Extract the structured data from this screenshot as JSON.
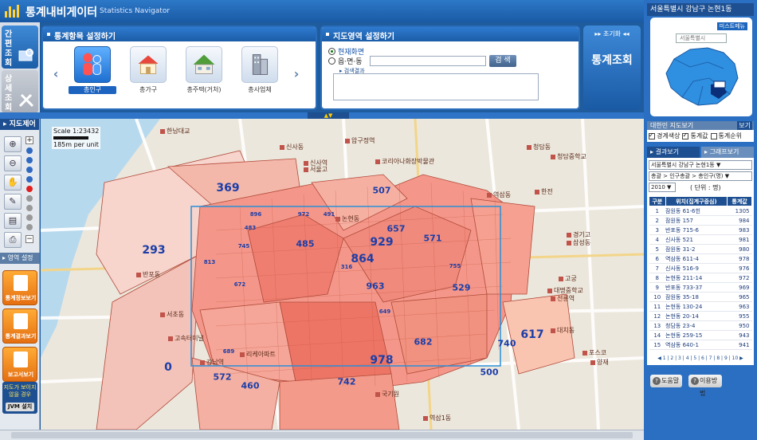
{
  "header": {
    "title": "통계내비게이터",
    "subtitle": "Statistics Navigator"
  },
  "mode_tabs": {
    "simple": "간편조회",
    "detail": "상세조회"
  },
  "stats_panel": {
    "title": "통계항목 설정하기",
    "items": [
      {
        "label": "총인구",
        "icon": "population-icon",
        "active": true
      },
      {
        "label": "총가구",
        "icon": "household-icon",
        "active": false
      },
      {
        "label": "총주택(거처)",
        "icon": "housing-icon",
        "active": false
      },
      {
        "label": "총사업체",
        "icon": "business-icon",
        "active": false
      }
    ]
  },
  "area_panel": {
    "title": "지도영역 설정하기",
    "current_screen": "현재화면",
    "region_option": "읍·면·동",
    "search_button": "검 색",
    "search_result_label": "검색결과",
    "region_input_value": ""
  },
  "query_panel": {
    "reset": "초기화",
    "query": "통계조회"
  },
  "map_tools": {
    "title": "지도제어",
    "layer_title": "영역 설정"
  },
  "side_cards": [
    {
      "label": "통계정보보기"
    },
    {
      "label": "통계결과보기"
    },
    {
      "label": "보고서보기"
    }
  ],
  "jvm": {
    "notice": "지도가 보이지 않을 경우",
    "button": "JVM 설치"
  },
  "map": {
    "scale_label": "Scale 1:23432",
    "scale_unit": "185m per unit",
    "region_values": [
      {
        "v": "369",
        "size": "big"
      },
      {
        "v": "293",
        "size": "big"
      },
      {
        "v": "0",
        "size": "big"
      },
      {
        "v": "864",
        "size": "big"
      },
      {
        "v": "929",
        "size": "big"
      },
      {
        "v": "978",
        "size": "big"
      },
      {
        "v": "617",
        "size": "big"
      },
      {
        "v": "963",
        "size": "mid"
      },
      {
        "v": "571",
        "size": "mid"
      },
      {
        "v": "657",
        "size": "mid"
      },
      {
        "v": "507",
        "size": "mid"
      },
      {
        "v": "485",
        "size": "mid"
      },
      {
        "v": "682",
        "size": "mid"
      },
      {
        "v": "529",
        "size": "mid"
      },
      {
        "v": "460",
        "size": "mid"
      },
      {
        "v": "742",
        "size": "mid"
      },
      {
        "v": "572",
        "size": "mid"
      },
      {
        "v": "500",
        "size": "mid"
      },
      {
        "v": "740",
        "size": "mid"
      },
      {
        "v": "972",
        "size": "sm"
      },
      {
        "v": "896",
        "size": "sm"
      },
      {
        "v": "483",
        "size": "sm"
      },
      {
        "v": "745",
        "size": "sm"
      },
      {
        "v": "672",
        "size": "sm"
      },
      {
        "v": "316",
        "size": "sm"
      },
      {
        "v": "649",
        "size": "sm"
      },
      {
        "v": "689",
        "size": "sm"
      },
      {
        "v": "491",
        "size": "sm"
      },
      {
        "v": "813",
        "size": "sm"
      },
      {
        "v": "755",
        "size": "sm"
      }
    ],
    "poi_labels": [
      "신사동",
      "압구정역",
      "코리아나화장박물관",
      "청담동",
      "논현동",
      "역삼동",
      "삼성동",
      "선릉역",
      "반포동",
      "서초동",
      "강남역",
      "대치동",
      "국기원",
      "역삼1동",
      "신사역",
      "한남대교",
      "고속터미널",
      "청담중학교",
      "리케아파트",
      "서울고",
      "양재",
      "고궁",
      "경기고",
      "한전",
      "포스코",
      "대명중학교"
    ]
  },
  "right_panel": {
    "region_title": "서울특별시 강남구 논현1동",
    "minimap_button": "미스트메뉴",
    "minimap_select": "서울특별시",
    "layers": {
      "title": "대한민 지도보기",
      "tag": "보기",
      "items": [
        {
          "label": "경계색상",
          "checked": true
        },
        {
          "label": "통계값",
          "checked": true
        },
        {
          "label": "통계순위",
          "checked": false
        }
      ]
    },
    "tabs": {
      "result": "결과보기",
      "graph": "그래프보기"
    },
    "select_region": "서울특별시 강남구 논현1동 ▼",
    "select_item": "총괄 > 인구총괄 > 총인구(명) ▼",
    "select_year": "2010 ▼",
    "unit": "( 단위 : 명)",
    "table_headers": [
      "구분",
      "위치(집계구중심)",
      "통계값"
    ],
    "table_rows": [
      [
        "1",
        "잠원동 61-6힌",
        "1305"
      ],
      [
        "2",
        "잠원동 157",
        "984"
      ],
      [
        "3",
        "반포동 715-6",
        "983"
      ],
      [
        "4",
        "신사동 521",
        "981"
      ],
      [
        "5",
        "잠원동 31-2",
        "980"
      ],
      [
        "6",
        "역삼동 611-4",
        "978"
      ],
      [
        "7",
        "신사동 516-9",
        "976"
      ],
      [
        "8",
        "논현동 211-14",
        "972"
      ],
      [
        "9",
        "반포동 733-37",
        "969"
      ],
      [
        "10",
        "잠원동 35-18",
        "965"
      ],
      [
        "11",
        "논현동 130-24",
        "963"
      ],
      [
        "12",
        "논현동 20-14",
        "955"
      ],
      [
        "13",
        "청담동 23-4",
        "950"
      ],
      [
        "14",
        "논현동 259-15",
        "943"
      ],
      [
        "15",
        "역삼동 640-1",
        "941"
      ]
    ],
    "pager": "◀ 1 | 2 | 3 | 4 | 5 | 6 | 7 | 8 | 9 | 10 ▶",
    "help_button": "도움말",
    "usage_button": "이용방법"
  },
  "colors": {
    "accent": "#1d4f91",
    "header": "#2a6fc2",
    "choropleth": "#f06a5a",
    "selection": "#2a8fd8"
  }
}
